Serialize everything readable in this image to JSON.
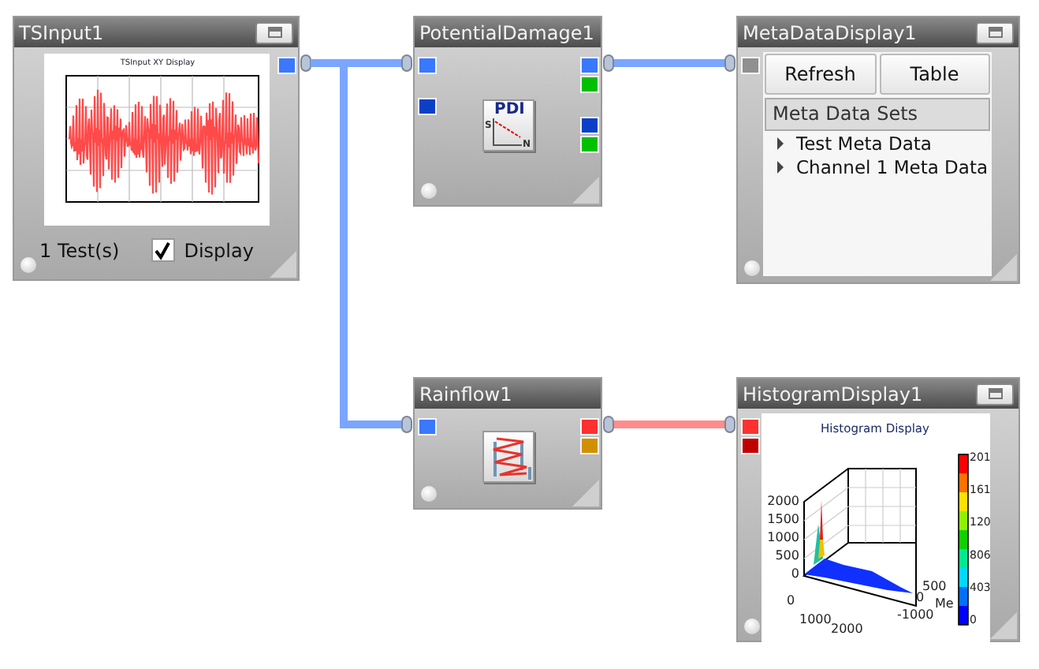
{
  "nodes": [
    {
      "kind": "input",
      "title": "TSInput1",
      "has_menu": true,
      "outputs": [
        [
          {
            "color": "#3a78ff"
          }
        ]
      ],
      "chart_title": "TSInput XY Display",
      "count": "1 Test(s)",
      "display": {
        "label": "Display",
        "checked": true
      }
    },
    {
      "kind": "damage",
      "title": "PotentialDamage1",
      "has_menu": false,
      "inputs": [
        [
          {
            "color": "#3a78ff"
          }
        ],
        [
          {
            "color": "#0a3fc8"
          }
        ]
      ],
      "outputs": [
        [
          {
            "color": "#3a78ff"
          },
          {
            "color": "#00c000"
          }
        ],
        [
          {
            "color": "#0a3fc8"
          },
          {
            "color": "#00c000"
          }
        ]
      ],
      "icon_texts": [
        "PDI",
        "S",
        "N"
      ]
    },
    {
      "kind": "metadata",
      "title": "MetaDataDisplay1",
      "has_menu": true,
      "inputs": [
        [
          {
            "color": "#909090"
          }
        ]
      ],
      "buttons": [
        "Refresh",
        "Table"
      ],
      "header": "Meta Data Sets",
      "tree": [
        {
          "label": "Test Meta Data",
          "expanded": false
        },
        {
          "label": "Channel 1 Meta Data",
          "expanded": false
        }
      ]
    },
    {
      "kind": "rainflow",
      "title": "Rainflow1",
      "has_menu": false,
      "inputs": [
        [
          {
            "color": "#3a78ff"
          }
        ]
      ],
      "outputs": [
        [
          {
            "color": "#ff3030"
          },
          {
            "color": "#d09000"
          }
        ]
      ]
    },
    {
      "kind": "histogram",
      "title": "HistogramDisplay1",
      "has_menu": true,
      "inputs": [
        [
          {
            "color": "#ff3030"
          },
          {
            "color": "#c00000"
          }
        ]
      ],
      "chart_title": "Histogram Display",
      "z_labels": [
        "2000",
        "1500",
        "1000",
        "500",
        "0"
      ],
      "x_labels": [
        "0",
        "1000",
        "2000"
      ],
      "y_labels": [
        "500",
        "0",
        "-1000"
      ],
      "axis_name": "Me",
      "scale_labels": [
        "201",
        "161",
        "120",
        "806",
        "403",
        "0"
      ]
    }
  ],
  "connections": [
    {
      "color": "#7aa6ff"
    },
    {
      "color": "#7aa6ff"
    },
    {
      "color": "#7aa6ff"
    },
    {
      "color": "#ff8c8c"
    }
  ]
}
